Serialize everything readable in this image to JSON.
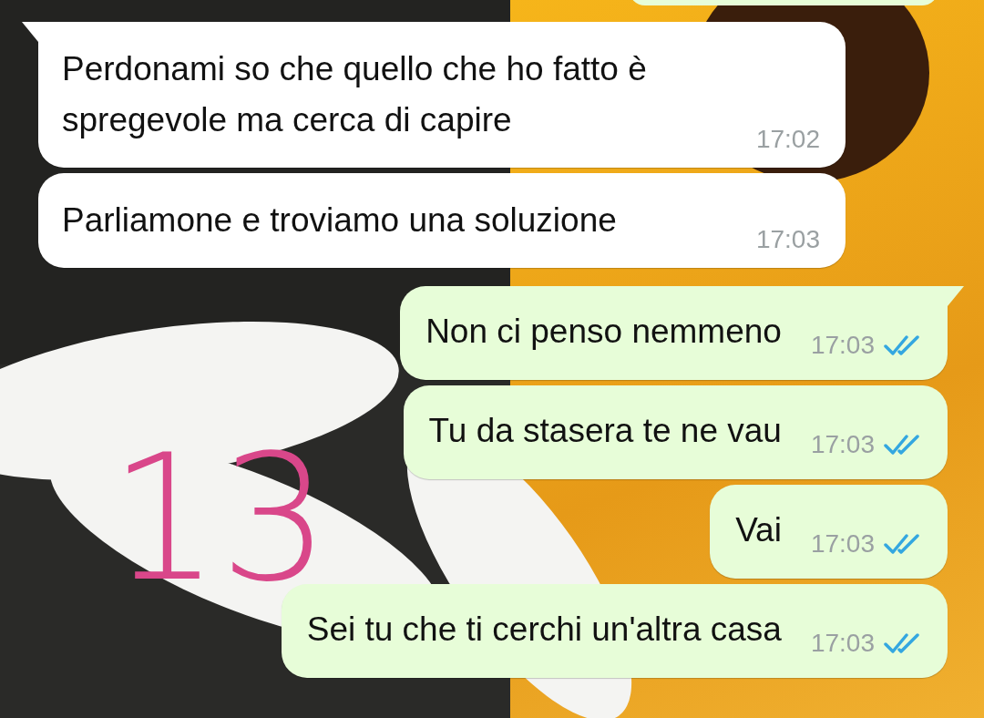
{
  "messages": [
    {
      "outgoing": false,
      "text": "Perdonami so che quello che ho fatto è spregevole ma cerca di capire",
      "time": "17:02"
    },
    {
      "outgoing": false,
      "text": "Parliamone e troviamo una soluzione",
      "time": "17:03"
    },
    {
      "outgoing": true,
      "text": "Non ci penso nemmeno",
      "time": "17:03",
      "read": true
    },
    {
      "outgoing": true,
      "text": "Tu da stasera te ne vau",
      "time": "17:03",
      "read": true
    },
    {
      "outgoing": true,
      "text": "Vai",
      "time": "17:03",
      "read": true
    },
    {
      "outgoing": true,
      "text": "Sei tu che ti cerchi un'altra casa",
      "time": "17:03",
      "read": true
    }
  ],
  "annotation": {
    "text": "13",
    "color": "#d9478a"
  }
}
